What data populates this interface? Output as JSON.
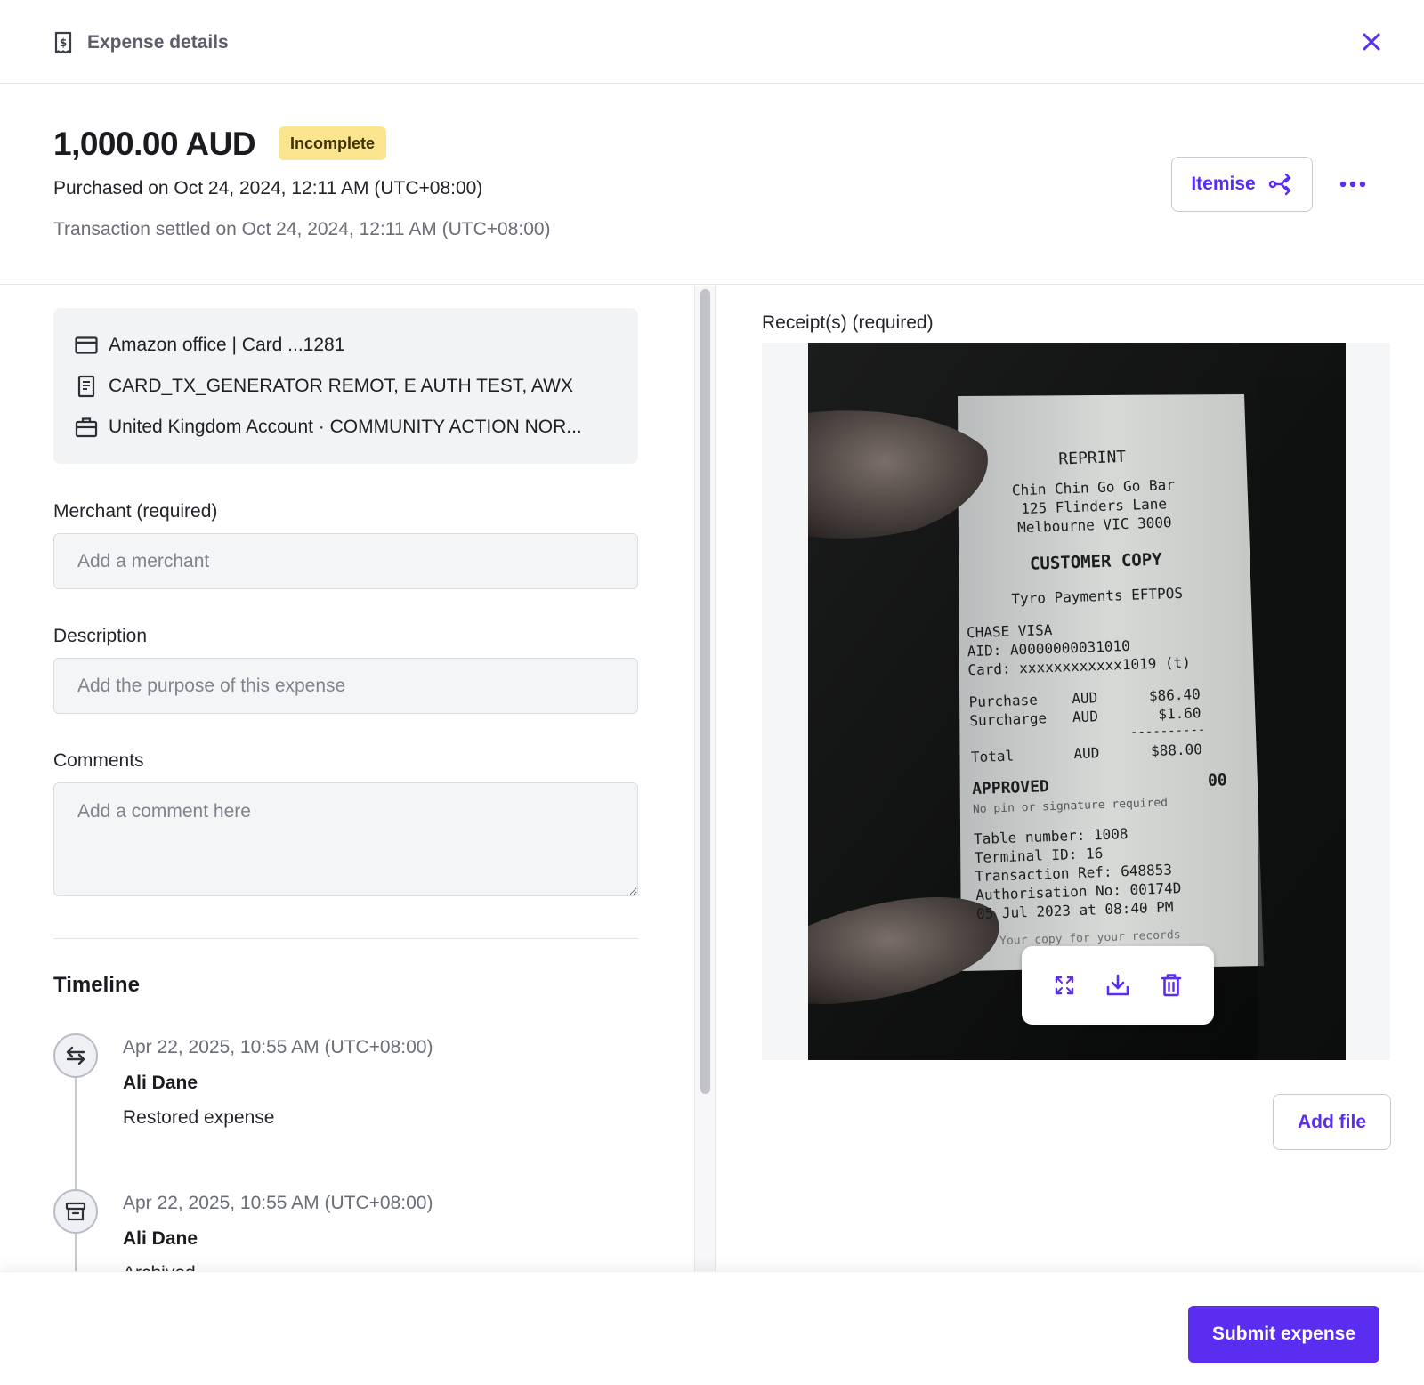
{
  "header": {
    "title": "Expense details",
    "doc_icon": "receipt-dollar-icon",
    "close_icon": "close-icon"
  },
  "summary": {
    "amount": "1,000.00 AUD",
    "status": "Incomplete",
    "purchased": "Purchased on Oct 24, 2024, 12:11 AM (UTC+08:00)",
    "settled": "Transaction settled on Oct 24, 2024, 12:11 AM (UTC+08:00)",
    "itemise_label": "Itemise"
  },
  "info": {
    "card": "Amazon office | Card ...1281",
    "transaction": "CARD_TX_GENERATOR REMOT, E AUTH TEST, AWX",
    "account": "United Kingdom Account · COMMUNITY ACTION NOR..."
  },
  "form": {
    "merchant_label": "Merchant (required)",
    "merchant_placeholder": "Add a merchant",
    "description_label": "Description",
    "description_placeholder": "Add the purpose of this expense",
    "comments_label": "Comments",
    "comments_placeholder": "Add a comment here"
  },
  "timeline": {
    "title": "Timeline",
    "events": [
      {
        "date": "Apr 22, 2025, 10:55 AM (UTC+08:00)",
        "user": "Ali Dane",
        "action": "Restored expense",
        "icon": "swap-arrows-icon"
      },
      {
        "date": "Apr 22, 2025, 10:55 AM (UTC+08:00)",
        "user": "Ali Dane",
        "action": "Archived",
        "icon": "archive-icon"
      }
    ]
  },
  "receipt": {
    "label": "Receipt(s) (required)",
    "add_file_label": "Add file",
    "lines": {
      "reprint": "REPRINT",
      "store": "Chin Chin Go Go Bar",
      "address1": "125 Flinders Lane",
      "address2": "Melbourne VIC 3000",
      "copy": "CUSTOMER COPY",
      "provider": "Tyro Payments EFTPOS",
      "card_type": "CHASE VISA",
      "aid": "AID: A0000000031010",
      "card_no": "Card: xxxxxxxxxxxx1019 (t)",
      "purchase": "Purchase    AUD      $86.40",
      "surcharge": "Surcharge   AUD       $1.60",
      "dashes": "----------",
      "total": "Total       AUD      $88.00",
      "approved": "APPROVED",
      "approved_code": "00",
      "no_pin": "No pin or signature required",
      "table": "Table number: 1008",
      "terminal": "Terminal ID: 16",
      "txn_ref": "Transaction Ref: 648853",
      "auth": "Authorisation No: 00174D",
      "datetime": "05 Jul 2023 at 08:40 PM",
      "footer": "Your copy for your records"
    }
  },
  "footer": {
    "submit_label": "Submit expense"
  },
  "colors": {
    "accent": "#5A2DF0",
    "badge_bg": "#FBE58E",
    "panel_bg": "#F2F3F5"
  }
}
